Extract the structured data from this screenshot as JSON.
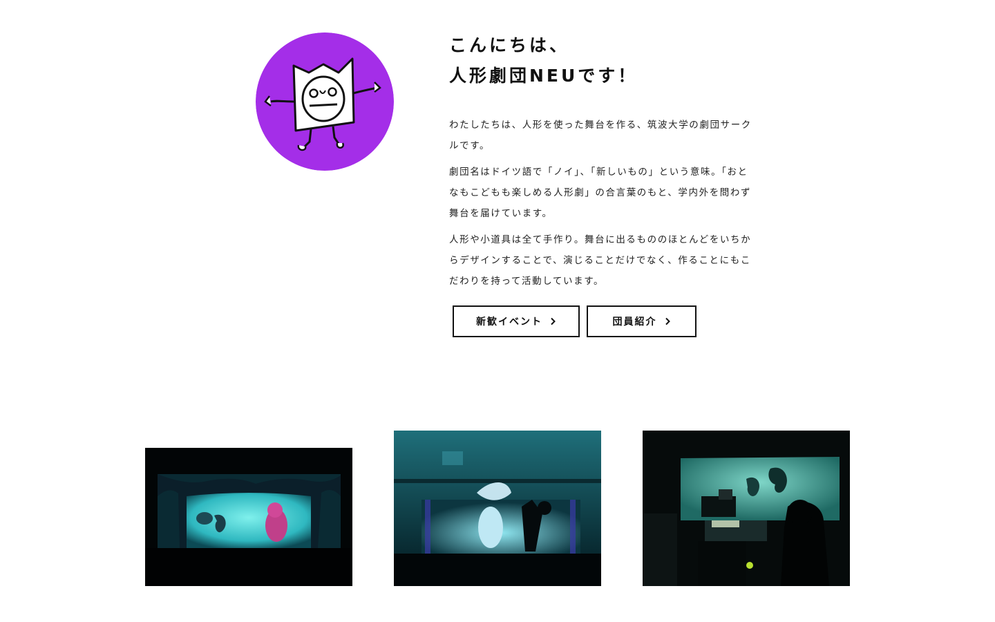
{
  "brand": {
    "accent_color": "#a42ee8"
  },
  "mascot": {
    "icon": "mascot-character-icon"
  },
  "intro": {
    "headline_line1": "こんにちは、",
    "headline_line2": "人形劇団NEUです！",
    "paragraphs": [
      "わたしたちは、人形を使った舞台を作る、筑波大学の劇団サークルです。",
      "劇団名はドイツ語で「ノイ」、「新しいもの」という意味。「おとなもこどもも楽しめる人形劇」の合言葉のもと、学内外を問わず舞台を届けています。",
      "人形や小道具は全て手作り。舞台に出るもののほとんどをいちからデザインすることで、演じることだけでなく、作ることにもこだわりを持って活動しています。"
    ]
  },
  "buttons": {
    "event_label": "新歓イベント",
    "members_label": "団員紹介",
    "chevron_icon": "chevron-right-icon"
  },
  "photos": [
    {
      "icon": "shadow-puppet-stage-photo"
    },
    {
      "icon": "puppet-performance-photo"
    },
    {
      "icon": "projector-shadow-play-photo"
    }
  ]
}
